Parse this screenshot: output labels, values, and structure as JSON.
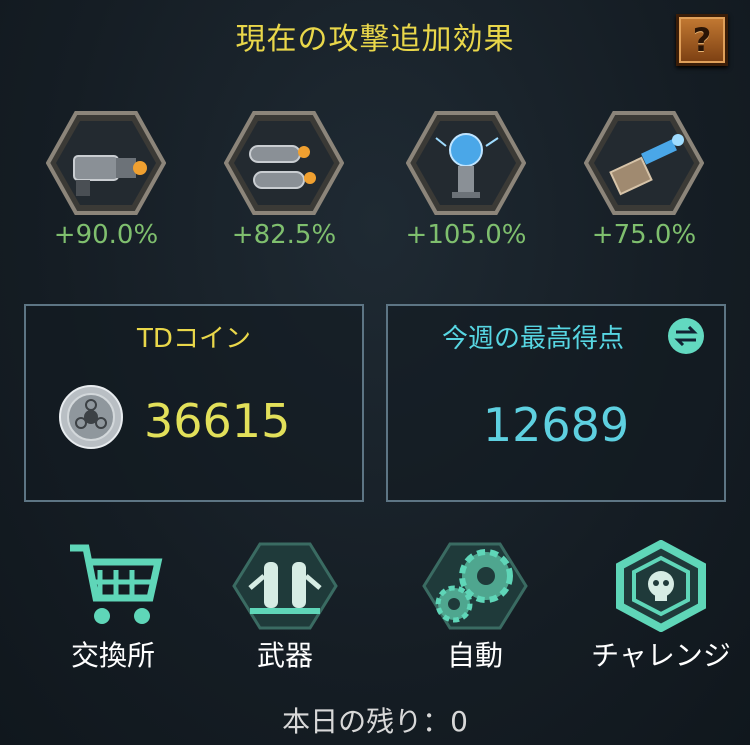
{
  "header": {
    "title": "現在の攻撃追加効果",
    "help_label": "?"
  },
  "buffs": [
    {
      "icon": "gatling-gun-icon",
      "value": "+90.0%"
    },
    {
      "icon": "twin-cannon-icon",
      "value": "+82.5%"
    },
    {
      "icon": "tesla-coil-icon",
      "value": "+105.0%"
    },
    {
      "icon": "laser-cannon-icon",
      "value": "+75.0%"
    }
  ],
  "coin_panel": {
    "title": "TDコイン",
    "value": "36615",
    "icon": "coin-icon"
  },
  "score_panel": {
    "title": "今週の最高得点",
    "value": "12689",
    "icon": "swap-icon"
  },
  "menu": [
    {
      "label": "交換所",
      "icon": "shop-cart-icon"
    },
    {
      "label": "武器",
      "icon": "weapons-icon"
    },
    {
      "label": "自動",
      "icon": "gears-icon"
    },
    {
      "label": "チャレンジ",
      "icon": "challenge-skull-icon"
    }
  ],
  "footer": {
    "remaining": "本日の残り：0"
  },
  "colors": {
    "title": "#e9d74a",
    "buff_value": "#7fbf6e",
    "coin_value": "#e2e05a",
    "score_value": "#5ed0e0",
    "menu_glow": "#5fd6b8"
  }
}
